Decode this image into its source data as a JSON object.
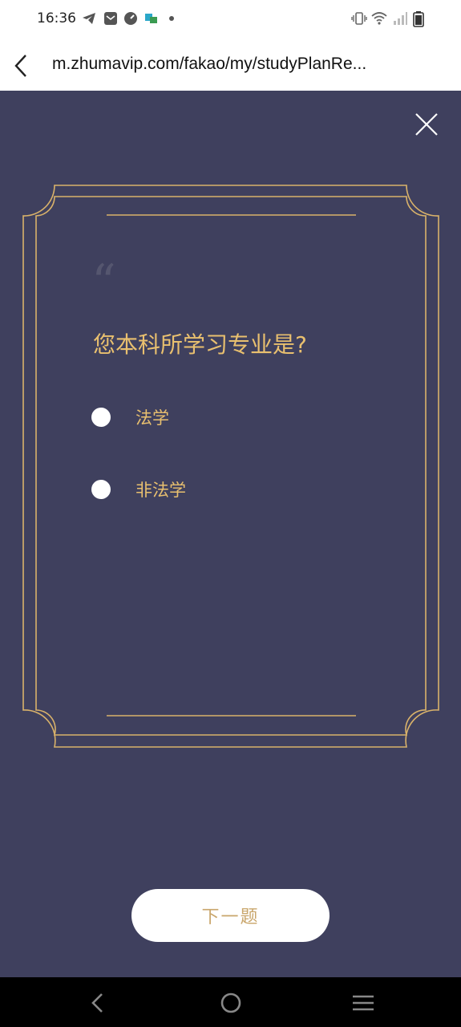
{
  "status_bar": {
    "time": "16:36"
  },
  "browser": {
    "url": "m.zhumavip.com/fakao/my/studyPlanRe..."
  },
  "quiz": {
    "question": "您本科所学习专业是?",
    "options": [
      {
        "label": "法学"
      },
      {
        "label": "非法学"
      }
    ],
    "next_button": "下一题"
  },
  "colors": {
    "background": "#3f405e",
    "accent": "#e9c06f",
    "button_text": "#c9a66b"
  },
  "icons": {
    "status": [
      "telegram-icon",
      "mail-icon",
      "app-icon",
      "app-icon-2",
      "dot-icon",
      "vibrate-icon",
      "wifi-icon",
      "signal-icon",
      "battery-icon"
    ],
    "browser": [
      "back-arrow-icon"
    ],
    "main": [
      "close-icon",
      "quote-icon"
    ],
    "nav": [
      "nav-back-icon",
      "nav-home-icon",
      "nav-menu-icon"
    ]
  }
}
